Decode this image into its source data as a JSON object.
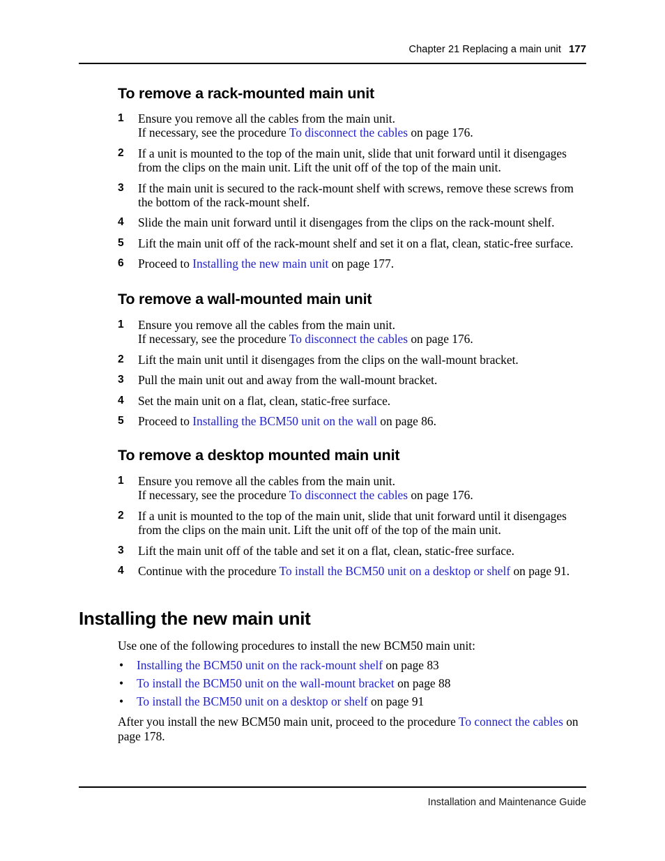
{
  "header": {
    "chapter_label": "Chapter 21  Replacing a main unit",
    "page_number": "177"
  },
  "footer": {
    "guide_title": "Installation and Maintenance Guide"
  },
  "colors": {
    "link": "#2222cc",
    "text": "#000000",
    "rule": "#000000"
  },
  "sections": {
    "rack": {
      "heading": "To remove a rack-mounted main unit",
      "steps": [
        {
          "num": "1",
          "line1": "Ensure you remove all the cables from the main unit.",
          "line2_pre": "If necessary, see the procedure ",
          "line2_link": "To disconnect the cables",
          "line2_post": " on page 176."
        },
        {
          "num": "2",
          "text": "If a unit is mounted to the top of the main unit, slide that unit forward until it disengages from the clips on the main unit. Lift the unit off of the top of the main unit."
        },
        {
          "num": "3",
          "text": "If the main unit is secured to the rack-mount shelf with screws, remove these screws from the bottom of the rack-mount shelf."
        },
        {
          "num": "4",
          "text": "Slide the main unit forward until it disengages from the clips on the rack-mount shelf."
        },
        {
          "num": "5",
          "text": "Lift the main unit off of the rack-mount shelf and set it on a flat, clean, static-free surface."
        },
        {
          "num": "6",
          "pre": "Proceed to ",
          "link": "Installing the new main unit",
          "post": " on page 177."
        }
      ]
    },
    "wall": {
      "heading": "To remove a wall-mounted main unit",
      "steps": [
        {
          "num": "1",
          "line1": "Ensure you remove all the cables from the main unit.",
          "line2_pre": "If necessary, see the procedure ",
          "line2_link": "To disconnect the cables",
          "line2_post": " on page 176."
        },
        {
          "num": "2",
          "text": "Lift the main unit until it disengages from the clips on the wall-mount bracket."
        },
        {
          "num": "3",
          "text": "Pull the main unit out and away from the wall-mount bracket."
        },
        {
          "num": "4",
          "text": "Set the main unit on a flat, clean, static-free surface."
        },
        {
          "num": "5",
          "pre": "Proceed to ",
          "link": "Installing the BCM50 unit on the wall",
          "post": " on page 86."
        }
      ]
    },
    "desktop": {
      "heading": "To remove a desktop mounted main unit",
      "steps": [
        {
          "num": "1",
          "line1": "Ensure you remove all the cables from the main unit.",
          "line2_pre": "If necessary, see the procedure ",
          "line2_link": "To disconnect the cables",
          "line2_post": " on page 176."
        },
        {
          "num": "2",
          "text": "If a unit is mounted to the top of the main unit, slide that unit forward until it disengages from the clips on the main unit. Lift the unit off of the top of the main unit."
        },
        {
          "num": "3",
          "text": "Lift the main unit off of the table and set it on a flat, clean, static-free surface."
        },
        {
          "num": "4",
          "pre": "Continue with the procedure ",
          "link": "To install the BCM50 unit on a desktop or shelf",
          "post": " on page 91."
        }
      ]
    },
    "installing": {
      "heading": "Installing the new main unit",
      "intro": "Use one of the following procedures to install the new BCM50 main unit:",
      "bullet_mark": "•",
      "bullets": [
        {
          "link": "Installing the BCM50 unit on the rack-mount shelf",
          "post": " on page 83"
        },
        {
          "link": "To install the BCM50 unit on the wall-mount bracket",
          "post": " on page 88"
        },
        {
          "link": "To install the BCM50 unit on a desktop or shelf",
          "post": " on page 91"
        }
      ],
      "closing_pre": "After you install the new BCM50 main unit, proceed to the procedure ",
      "closing_link": "To connect the cables",
      "closing_post": " on page 178."
    }
  }
}
